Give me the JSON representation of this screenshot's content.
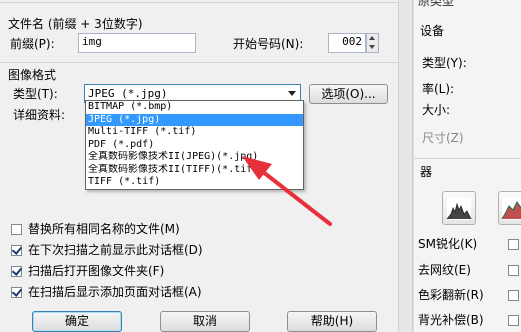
{
  "naming": {
    "group_title": "文件名 (前缀 + 3位数字)",
    "prefix_label": "前缀(P):",
    "prefix_value": "img",
    "start_label": "开始号码(N):",
    "start_value": "002"
  },
  "format": {
    "group_title": "图像格式",
    "type_label": "类型(T):",
    "selected": "JPEG (*.jpg)",
    "options_button": "选项(O)...",
    "details_label": "详细资料:",
    "options": [
      "BITMAP (*.bmp)",
      "JPEG (*.jpg)",
      "Multi-TIFF (*.tif)",
      "PDF (*.pdf)",
      "全真数码影像技术II(JPEG)(*.jpg)",
      "全真数码影像技术II(TIFF)(*.tif)",
      "TIFF (*.tif)"
    ]
  },
  "checkboxes": [
    {
      "label": "替换所有相同名称的文件(M)",
      "checked": false
    },
    {
      "label": "在下次扫描之前显示此对话框(D)",
      "checked": true
    },
    {
      "label": "扫描后打开图像文件夹(F)",
      "checked": true
    },
    {
      "label": "在扫描后显示添加页面对话框(A)",
      "checked": true
    }
  ],
  "buttons": {
    "ok": "确定",
    "cancel": "取消",
    "help": "帮助(H)"
  },
  "right_panel": {
    "top_text": "原类型",
    "section": "设备",
    "items": [
      "类型(Y):",
      "率(L):",
      "大小:",
      "尺寸(Z)"
    ],
    "filter_header": "器",
    "options": [
      "SM锐化(K)",
      "去网纹(E)",
      "色彩翻新(R)",
      "背光补偿(B)"
    ]
  },
  "colors": {
    "accent": "#3399ff",
    "arrow": "#e8303a"
  }
}
